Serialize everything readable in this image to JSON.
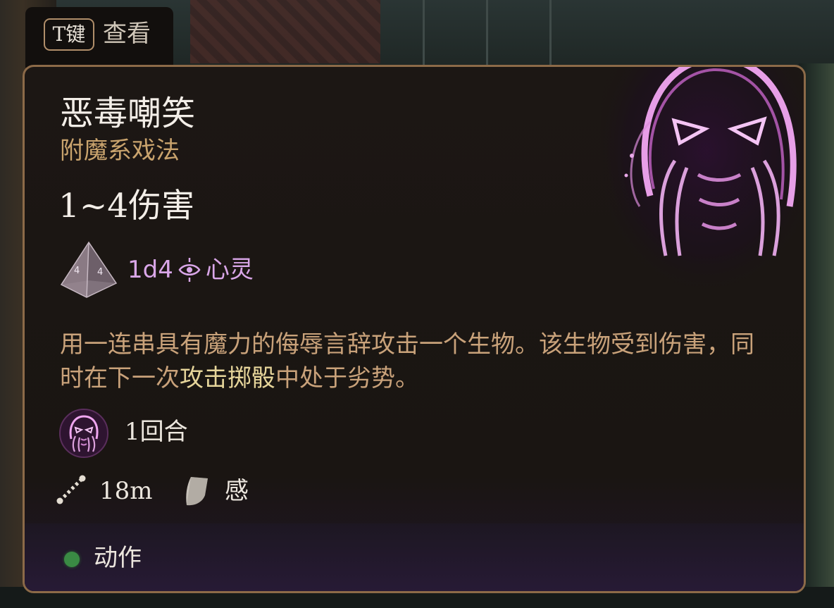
{
  "hotkey_hint": {
    "key": "T键",
    "label": "查看"
  },
  "spell": {
    "name": "恶毒嘲笑",
    "school": "附魔系戏法",
    "damage_range": "1~4伤害",
    "damage_dice": "1d4",
    "damage_type": "心灵",
    "description_part1": "用一连串具有魔力的侮辱言辞攻击一个生物。该生物受到伤害，同时在下一次",
    "description_keyword": "攻击掷骰",
    "description_part2": "中处于劣势。",
    "duration": "1回合",
    "range": "18m",
    "saving_throw": "感",
    "action_type": "动作"
  },
  "icons": {
    "portrait": "vicious-mockery-portrait-icon",
    "dice": "d4-dice-icon",
    "damage_type": "psychic-icon",
    "condition": "mockery-condition-icon",
    "range": "range-ruler-icon",
    "save": "shield-save-icon",
    "action": "action-dot-icon"
  },
  "colors": {
    "title": "#f3eee8",
    "school": "#c9a36d",
    "psychic": "#d9a6e8",
    "description": "#c9a27a",
    "keyword": "#e6d59a",
    "frame": "#8c6a48",
    "action_dot": "#3a8a44"
  }
}
